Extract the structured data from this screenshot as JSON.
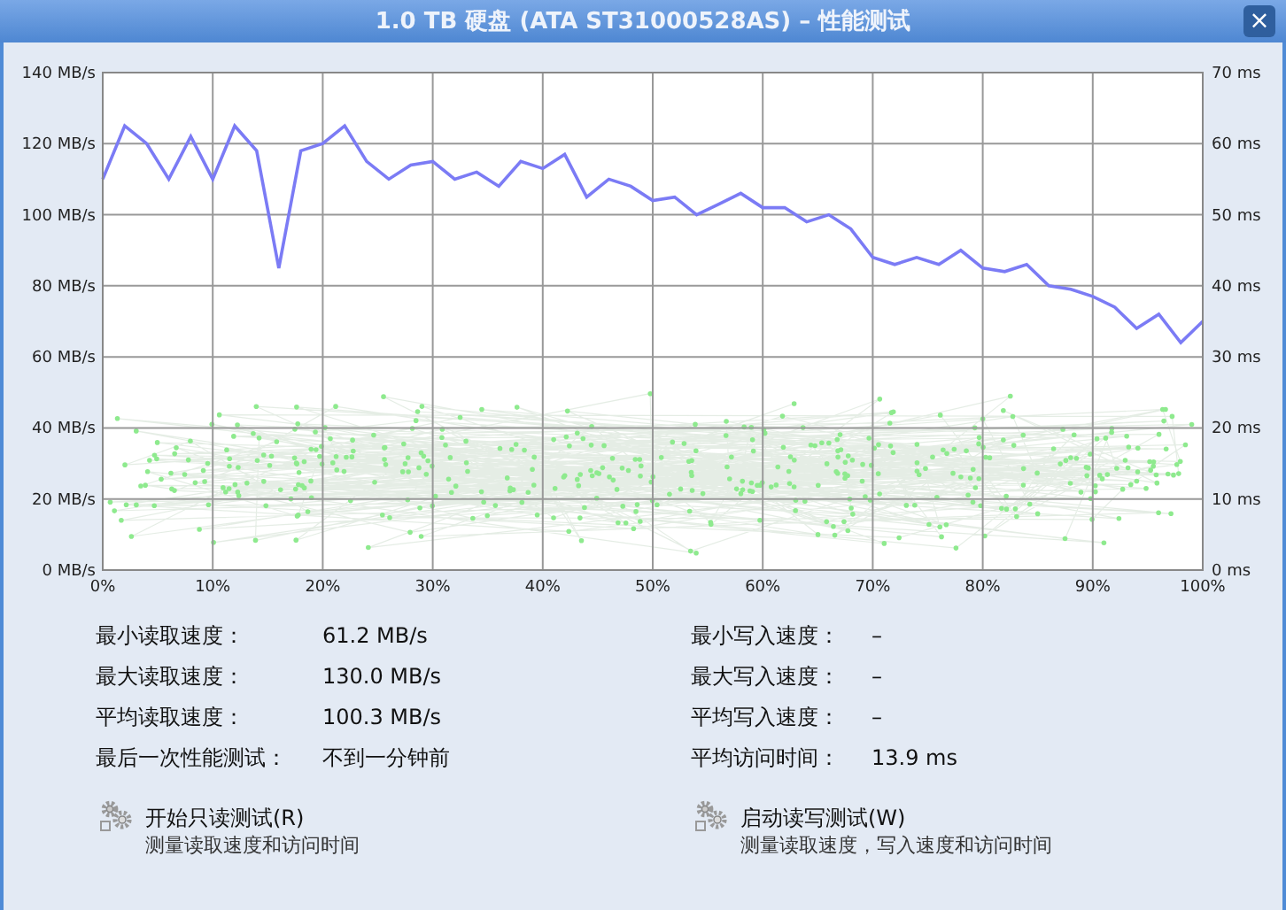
{
  "window": {
    "title": "1.0 TB 硬盘 (ATA ST31000528AS) – 性能测试",
    "close": "×"
  },
  "chart": {
    "right_axis_labels": [
      "70 ms",
      "60 ms",
      "50 ms",
      "40 ms",
      "30 ms",
      "20 ms",
      "10 ms",
      "0 ms"
    ],
    "chart_data": {
      "type": "line",
      "x": [
        0,
        2,
        4,
        6,
        8,
        10,
        12,
        14,
        16,
        18,
        20,
        22,
        24,
        26,
        28,
        30,
        32,
        34,
        36,
        38,
        40,
        42,
        44,
        46,
        48,
        50,
        52,
        54,
        56,
        58,
        60,
        62,
        64,
        66,
        68,
        70,
        72,
        74,
        76,
        78,
        80,
        82,
        84,
        86,
        88,
        90,
        92,
        94,
        96,
        98,
        100
      ],
      "grid": true,
      "series": [
        {
          "color": "#7b7bf5",
          "values": [
            110,
            125,
            120,
            110,
            122,
            110,
            125,
            118,
            85,
            118,
            120,
            125,
            115,
            110,
            114,
            115,
            110,
            112,
            108,
            115,
            113,
            117,
            105,
            110,
            108,
            104,
            105,
            100,
            103,
            106,
            102,
            102,
            98,
            100,
            96,
            88,
            86,
            88,
            86,
            90,
            85,
            84,
            86,
            80,
            79,
            77,
            74,
            68,
            72,
            64,
            70
          ]
        }
      ],
      "xlim": [
        0,
        100
      ],
      "ylim": [
        0,
        140
      ],
      "xticks": [
        {
          "value": 0,
          "label": "0%"
        },
        {
          "value": 10,
          "label": "10%"
        },
        {
          "value": 20,
          "label": "20%"
        },
        {
          "value": 30,
          "label": "30%"
        },
        {
          "value": 40,
          "label": "40%"
        },
        {
          "value": 50,
          "label": "50%"
        },
        {
          "value": 60,
          "label": "60%"
        },
        {
          "value": 70,
          "label": "70%"
        },
        {
          "value": 80,
          "label": "80%"
        },
        {
          "value": 90,
          "label": "90%"
        },
        {
          "value": 100,
          "label": "100%"
        }
      ],
      "yticks": [
        {
          "value": 0,
          "label": "0 MB/s"
        },
        {
          "value": 20,
          "label": "20 MB/s"
        },
        {
          "value": 40,
          "label": "40 MB/s"
        },
        {
          "value": 60,
          "label": "60 MB/s"
        },
        {
          "value": 80,
          "label": "80 MB/s"
        },
        {
          "value": 100,
          "label": "100 MB/s"
        },
        {
          "value": 120,
          "label": "120 MB/s"
        },
        {
          "value": 140,
          "label": "140 MB/s"
        }
      ]
    }
  },
  "stats": [
    {
      "label": "最小读取速度：",
      "value": "61.2 MB/s"
    },
    {
      "label": "最小写入速度：",
      "value": "–"
    },
    {
      "label": "最大读取速度：",
      "value": "130.0 MB/s"
    },
    {
      "label": "最大写入速度：",
      "value": "–"
    },
    {
      "label": "平均读取速度：",
      "value": "100.3 MB/s"
    },
    {
      "label": "平均写入速度：",
      "value": "–"
    },
    {
      "label": "最后一次性能测试：",
      "value": "不到一分钟前"
    },
    {
      "label": "平均访问时间：",
      "value": "13.9 ms"
    }
  ],
  "actions": [
    {
      "label": "开始只读测试(R)",
      "description": "测量读取速度和访问时间"
    },
    {
      "label": "启动读写测试(W)",
      "description": "测量读取速度，写入速度和访问时间"
    }
  ]
}
